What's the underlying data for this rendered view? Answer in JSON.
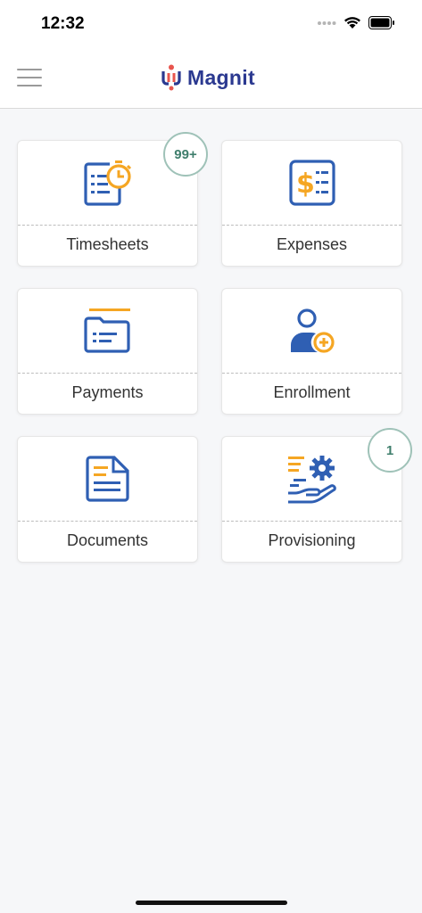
{
  "status_bar": {
    "time": "12:32"
  },
  "header": {
    "logo_text": "Magnit"
  },
  "tiles": [
    {
      "label": "Timesheets",
      "badge": "99+",
      "icon": "timesheet-clock-icon"
    },
    {
      "label": "Expenses",
      "badge": "",
      "icon": "dollar-document-icon"
    },
    {
      "label": "Payments",
      "badge": "",
      "icon": "folder-icon"
    },
    {
      "label": "Enrollment",
      "badge": "",
      "icon": "add-user-icon"
    },
    {
      "label": "Documents",
      "badge": "",
      "icon": "document-icon"
    },
    {
      "label": "Provisioning",
      "badge": "1",
      "icon": "hand-gear-icon"
    }
  ],
  "colors": {
    "blue": "#2f5fb3",
    "orange": "#f5a623",
    "brand": "#2b3990",
    "badge_text": "#3f7e6c"
  }
}
